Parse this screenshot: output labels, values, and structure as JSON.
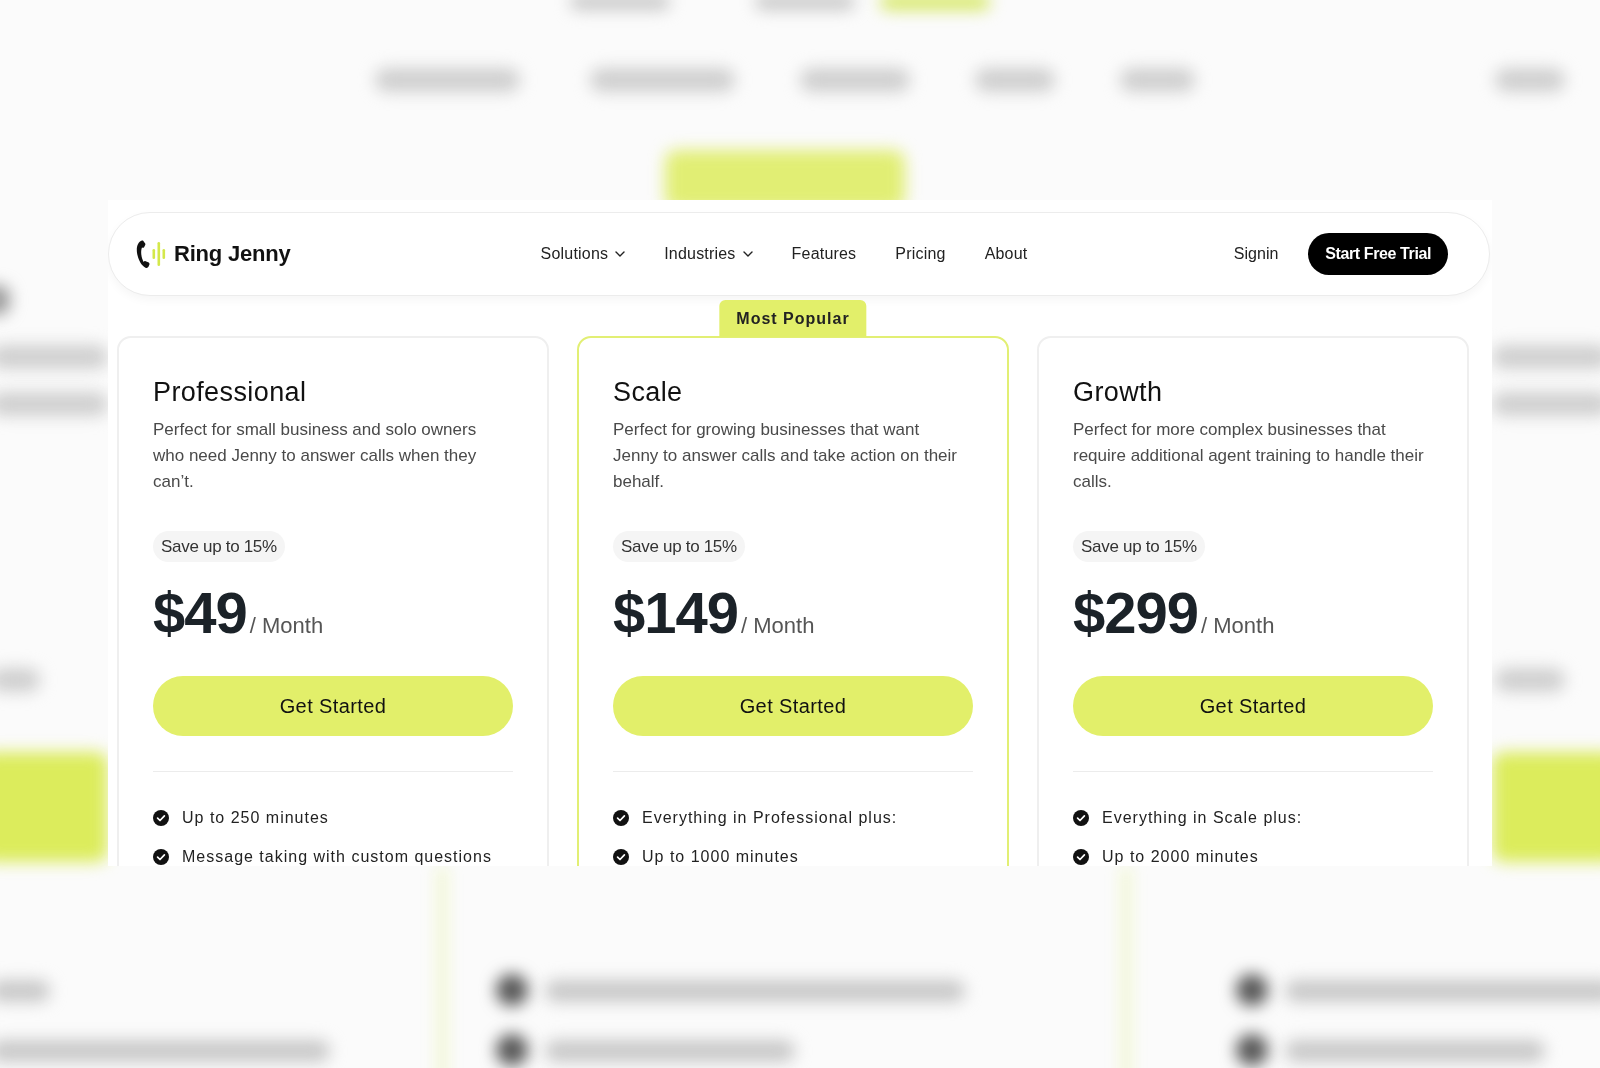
{
  "header": {
    "brand": "Ring Jenny",
    "nav": [
      {
        "label": "Solutions",
        "dropdown": true
      },
      {
        "label": "Industries",
        "dropdown": true
      },
      {
        "label": "Features",
        "dropdown": false
      },
      {
        "label": "Pricing",
        "dropdown": false
      },
      {
        "label": "About",
        "dropdown": false
      }
    ],
    "signin": "Signin",
    "cta": "Start Free Trial"
  },
  "plans": [
    {
      "name": "Professional",
      "featured": false,
      "description": "Perfect for small business and solo owners who need Jenny to answer calls when they can’t.",
      "save_badge": "Save up to 15%",
      "price": "$49",
      "period": "/ Month",
      "button": "Get Started",
      "features": [
        "Up to 250 minutes",
        "Message taking with custom questions"
      ]
    },
    {
      "name": "Scale",
      "featured": true,
      "badge": "Most Popular",
      "description": "Perfect for growing businesses that want Jenny to answer calls and take action on their behalf.",
      "save_badge": "Save up to 15%",
      "price": "$149",
      "period": "/ Month",
      "button": "Get Started",
      "features": [
        "Everything in Professional plus:",
        "Up to 1000 minutes"
      ]
    },
    {
      "name": "Growth",
      "featured": false,
      "description": "Perfect for more complex businesses that require additional agent training to handle their calls.",
      "save_badge": "Save up to 15%",
      "price": "$299",
      "period": "/ Month",
      "button": "Get Started",
      "features": [
        "Everything in Scale plus:",
        "Up to 2000 minutes"
      ]
    }
  ]
}
